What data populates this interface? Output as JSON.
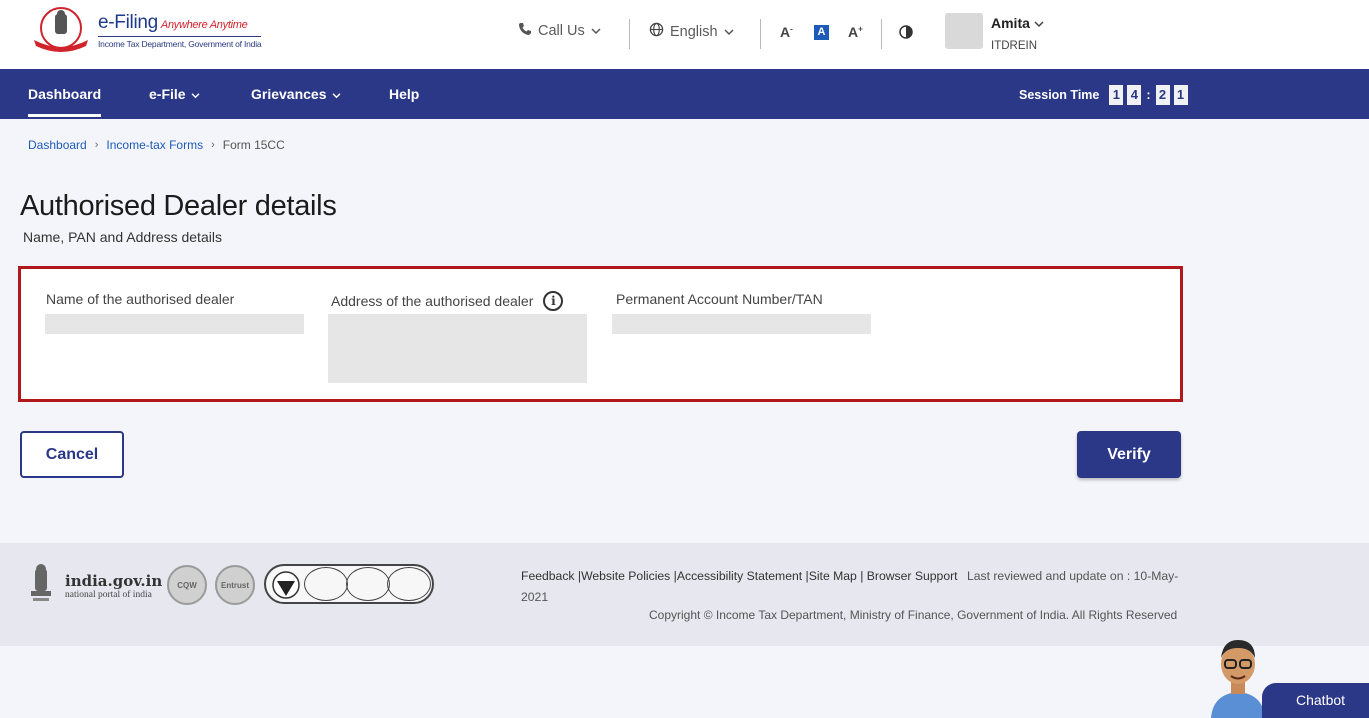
{
  "header": {
    "logo_title": "e-Filing",
    "logo_tagline": "Anywhere Anytime",
    "logo_subtitle": "Income Tax Department, Government of India",
    "call_us": "Call Us",
    "language": "English",
    "font_decrease": "A",
    "font_normal": "A",
    "font_increase": "A",
    "user_name": "Amita",
    "user_id": "ITDREIN"
  },
  "nav": {
    "items": [
      {
        "label": "Dashboard",
        "active": true
      },
      {
        "label": "e-File",
        "dropdown": true
      },
      {
        "label": "Grievances",
        "dropdown": true
      },
      {
        "label": "Help"
      }
    ],
    "session_label": "Session Time",
    "session_digits": [
      "1",
      "4",
      "2",
      "1"
    ]
  },
  "breadcrumb": [
    {
      "label": "Dashboard",
      "link": true
    },
    {
      "label": "Income-tax Forms",
      "link": true
    },
    {
      "label": "Form 15CC",
      "link": false
    }
  ],
  "page": {
    "title": "Authorised Dealer details",
    "subtitle": "Name, PAN and Address details"
  },
  "fields": {
    "name_label": "Name of the authorised dealer",
    "address_label": "Address of the authorised dealer",
    "pan_label": "Permanent Account Number/TAN"
  },
  "buttons": {
    "cancel": "Cancel",
    "verify": "Verify"
  },
  "footer": {
    "india_gov": "india.gov.in",
    "india_gov_sub": "national portal of india",
    "links": [
      "Feedback",
      "Website Policies",
      "Accessibility Statement",
      "Site Map",
      "Browser Support"
    ],
    "reviewed": "Last reviewed and update on : 10-May-2021",
    "copyright": "Copyright © Income Tax Department, Ministry of Finance, Government of India. All Rights Reserved"
  },
  "chatbot": {
    "label": "Chatbot"
  },
  "colors": {
    "primary": "#2b3787",
    "highlight_border": "#b0181c",
    "link": "#1e5bb8"
  }
}
